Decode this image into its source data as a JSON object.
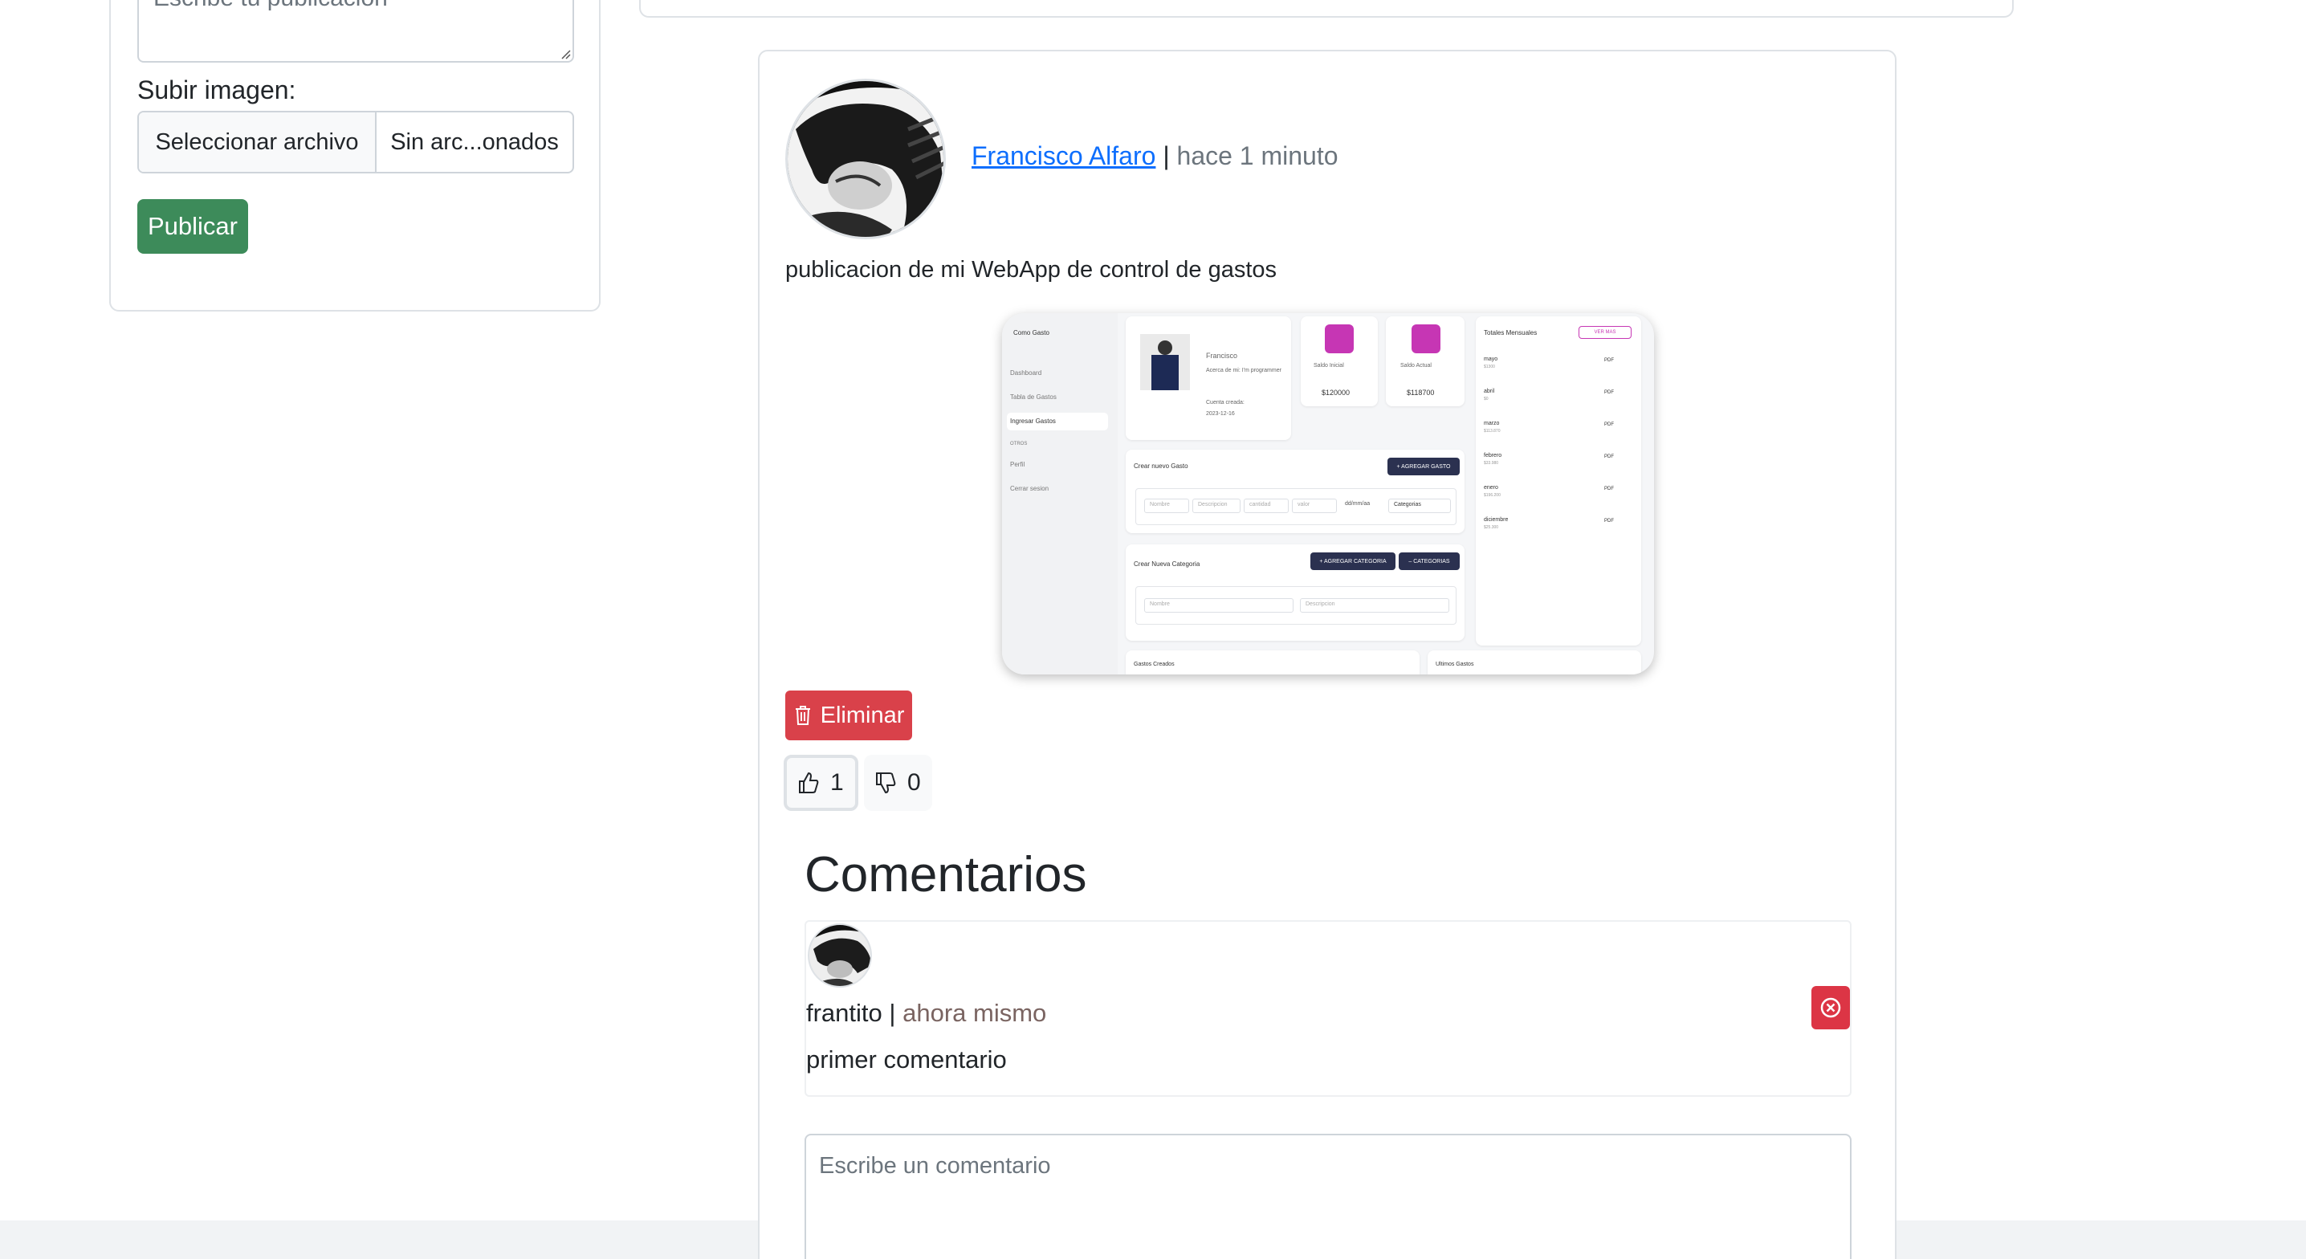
{
  "sidebar_form": {
    "textarea_placeholder": "Escribe tu publicación",
    "upload_label": "Subir imagen:",
    "file_button": "Seleccionar archivo",
    "file_status": "Sin arc...onados",
    "publish_button": "Publicar"
  },
  "post": {
    "author": "Francisco Alfaro",
    "separator": "|",
    "time": "hace 1 minuto",
    "text": "publicacion de mi WebApp de control de gastos",
    "delete_button": "Eliminar",
    "likes": "1",
    "dislikes": "0",
    "image": {
      "app_name": "Como Gasto",
      "menu": [
        "Dashboard",
        "Tabla de Gastos",
        "Ingresar Gastos",
        "OTROS",
        "Perfil",
        "Cerrar sesion"
      ],
      "profile_name": "Francisco",
      "profile_about": "Acerca de mi: I'm programmer",
      "profile_created": "Cuenta creada:",
      "profile_date": "2023-12-16",
      "saldo_inicial_label": "Saldo Inicial",
      "saldo_inicial": "$120000",
      "saldo_actual_label": "Saldo Actual",
      "saldo_actual": "$118700",
      "totales_title": "Totales Mensuales",
      "ver_mas": "VER MAS",
      "months": [
        {
          "name": "mayo",
          "value": "$1300"
        },
        {
          "name": "abril",
          "value": "$0"
        },
        {
          "name": "marzo",
          "value": "$113.870"
        },
        {
          "name": "febrero",
          "value": "$33.980"
        },
        {
          "name": "enero",
          "value": "$196.200"
        },
        {
          "name": "diciembre",
          "value": "$25.300"
        }
      ],
      "pdf": "PDF",
      "crear_gasto": "Crear nuevo Gasto",
      "agregar_gasto": "+ AGREGAR GASTO",
      "gasto_fields": [
        "Nombre",
        "Descripcion",
        "cantidad",
        "valor",
        "dd/mm/aa",
        "Categorias"
      ],
      "crear_categoria": "Crear Nueva Categoria",
      "agregar_categoria": "+ AGREGAR CATEGORIA",
      "categorias_btn": "– CATEGORIAS",
      "categoria_fields": [
        "Nombre",
        "Descripcion"
      ],
      "gastos_creados": "Gastos Creados",
      "ultimos_gastos": "Ultimos Gastos"
    }
  },
  "comments": {
    "title": "Comentarios",
    "items": [
      {
        "user": "frantito",
        "separator": "|",
        "time": "ahora mismo",
        "text": "primer comentario"
      }
    ],
    "input_placeholder": "Escribe un comentario"
  }
}
